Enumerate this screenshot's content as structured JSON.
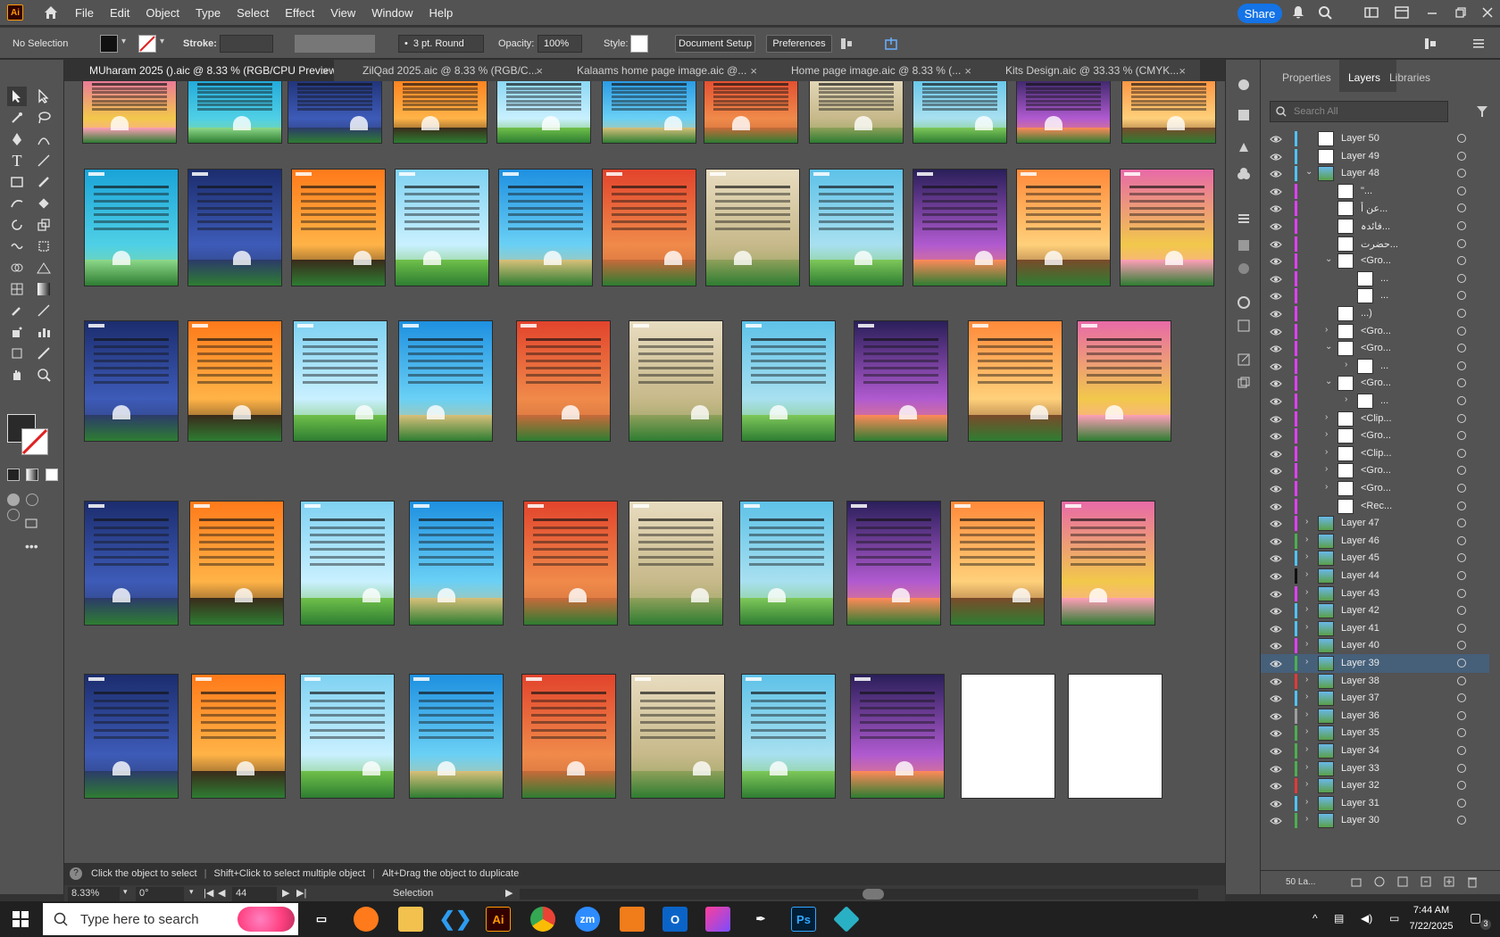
{
  "app": {
    "logo": "Ai",
    "menu": [
      "File",
      "Edit",
      "Object",
      "Type",
      "Select",
      "Effect",
      "View",
      "Window",
      "Help"
    ],
    "share_label": "Share"
  },
  "control_bar": {
    "selection_status": "No Selection",
    "stroke_label": "Stroke:",
    "brush_value": "3 pt. Round",
    "opacity_label": "Opacity:",
    "opacity_value": "100%",
    "style_label": "Style:",
    "document_setup_label": "Document Setup",
    "preferences_label": "Preferences"
  },
  "tabs": [
    {
      "label": "MUharam 2025 ().aic @ 8.33 % (RGB/CPU Preview)",
      "active": true
    },
    {
      "label": "ZilQad 2025.aic @ 8.33 % (RGB/C...",
      "active": false
    },
    {
      "label": "Kalaams home page image.aic @...",
      "active": false
    },
    {
      "label": "Home page image.aic @ 8.33 % (...",
      "active": false
    },
    {
      "label": "Kits Design.aic @ 33.33 % (CMYK...",
      "active": false
    }
  ],
  "panel_tabs": [
    "Properties",
    "Layers",
    "Libraries"
  ],
  "layers_search_placeholder": "Search All",
  "layers": [
    {
      "name": "Layer 50",
      "indent": 0,
      "color": "#4fc3f7",
      "chevron": "",
      "selected": false
    },
    {
      "name": "Layer 49",
      "indent": 0,
      "color": "#4fc3f7",
      "chevron": "",
      "selected": false
    },
    {
      "name": "Layer 48",
      "indent": 0,
      "color": "#4fc3f7",
      "chevron": "v",
      "selected": false
    },
    {
      "name": "\"...",
      "indent": 1,
      "color": "#e040fb",
      "chevron": "",
      "selected": false
    },
    {
      "name": "عن أ...",
      "indent": 1,
      "color": "#e040fb",
      "chevron": "",
      "selected": false
    },
    {
      "name": "فائدہ...",
      "indent": 1,
      "color": "#e040fb",
      "chevron": "",
      "selected": false
    },
    {
      "name": "حضرت...",
      "indent": 1,
      "color": "#e040fb",
      "chevron": "",
      "selected": false
    },
    {
      "name": "<Gro...",
      "indent": 1,
      "color": "#e040fb",
      "chevron": "v",
      "selected": false
    },
    {
      "name": "...",
      "indent": 2,
      "color": "#e040fb",
      "chevron": "",
      "selected": false
    },
    {
      "name": "...",
      "indent": 2,
      "color": "#e040fb",
      "chevron": "",
      "selected": false
    },
    {
      "name": "...)",
      "indent": 1,
      "color": "#e040fb",
      "chevron": "",
      "selected": false
    },
    {
      "name": "<Gro...",
      "indent": 1,
      "color": "#e040fb",
      "chevron": ">",
      "selected": false
    },
    {
      "name": "<Gro...",
      "indent": 1,
      "color": "#e040fb",
      "chevron": "v",
      "selected": false
    },
    {
      "name": "...",
      "indent": 2,
      "color": "#e040fb",
      "chevron": ">",
      "selected": false
    },
    {
      "name": "<Gro...",
      "indent": 1,
      "color": "#e040fb",
      "chevron": "v",
      "selected": false
    },
    {
      "name": "...",
      "indent": 2,
      "color": "#e040fb",
      "chevron": ">",
      "selected": false
    },
    {
      "name": "<Clip...",
      "indent": 1,
      "color": "#e040fb",
      "chevron": ">",
      "selected": false
    },
    {
      "name": "<Gro...",
      "indent": 1,
      "color": "#e040fb",
      "chevron": ">",
      "selected": false
    },
    {
      "name": "<Clip...",
      "indent": 1,
      "color": "#e040fb",
      "chevron": ">",
      "selected": false
    },
    {
      "name": "<Gro...",
      "indent": 1,
      "color": "#e040fb",
      "chevron": ">",
      "selected": false
    },
    {
      "name": "<Gro...",
      "indent": 1,
      "color": "#e040fb",
      "chevron": ">",
      "selected": false
    },
    {
      "name": "<Rec...",
      "indent": 1,
      "color": "#e040fb",
      "chevron": "",
      "selected": false
    },
    {
      "name": "Layer 47",
      "indent": 0,
      "color": "#e040fb",
      "chevron": ">",
      "selected": false
    },
    {
      "name": "Layer 46",
      "indent": 0,
      "color": "#4caf50",
      "chevron": ">",
      "selected": false
    },
    {
      "name": "Layer 45",
      "indent": 0,
      "color": "#4fc3f7",
      "chevron": ">",
      "selected": false
    },
    {
      "name": "Layer 44",
      "indent": 0,
      "color": "#111111",
      "chevron": ">",
      "selected": false
    },
    {
      "name": "Layer 43",
      "indent": 0,
      "color": "#e040fb",
      "chevron": ">",
      "selected": false
    },
    {
      "name": "Layer 42",
      "indent": 0,
      "color": "#4fc3f7",
      "chevron": ">",
      "selected": false
    },
    {
      "name": "Layer 41",
      "indent": 0,
      "color": "#4fc3f7",
      "chevron": ">",
      "selected": false
    },
    {
      "name": "Layer 40",
      "indent": 0,
      "color": "#e040fb",
      "chevron": ">",
      "selected": false
    },
    {
      "name": "Layer 39",
      "indent": 0,
      "color": "#4caf50",
      "chevron": ">",
      "selected": true
    },
    {
      "name": "Layer 38",
      "indent": 0,
      "color": "#e53935",
      "chevron": ">",
      "selected": false
    },
    {
      "name": "Layer 37",
      "indent": 0,
      "color": "#4fc3f7",
      "chevron": ">",
      "selected": false
    },
    {
      "name": "Layer 36",
      "indent": 0,
      "color": "#9e9e9e",
      "chevron": ">",
      "selected": false
    },
    {
      "name": "Layer 35",
      "indent": 0,
      "color": "#4caf50",
      "chevron": ">",
      "selected": false
    },
    {
      "name": "Layer 34",
      "indent": 0,
      "color": "#4caf50",
      "chevron": ">",
      "selected": false
    },
    {
      "name": "Layer 33",
      "indent": 0,
      "color": "#4caf50",
      "chevron": ">",
      "selected": false
    },
    {
      "name": "Layer 32",
      "indent": 0,
      "color": "#e53935",
      "chevron": ">",
      "selected": false
    },
    {
      "name": "Layer 31",
      "indent": 0,
      "color": "#4fc3f7",
      "chevron": ">",
      "selected": false
    },
    {
      "name": "Layer 30",
      "indent": 0,
      "color": "#4caf50",
      "chevron": ">",
      "selected": false
    }
  ],
  "layers_footer": "50 La...",
  "hint": {
    "part1": "Click the object to select",
    "part2": "Shift+Click to select multiple object",
    "part3": "Alt+Drag the object to duplicate"
  },
  "status": {
    "zoom": "8.33%",
    "rotation": "0°",
    "artboard": "44",
    "tool": "Selection"
  },
  "taskbar": {
    "search_placeholder": "Type here to search",
    "time": "7:44 AM",
    "date": "7/22/2025",
    "notifications": "3"
  },
  "artboard_palettes": [
    [
      "#e86aa8",
      "#f2c84b",
      "#ff9fb8"
    ],
    [
      "#1aa3d8",
      "#4fd0e6",
      "#8ed98a"
    ],
    [
      "#1c2d6e",
      "#3d5bb8",
      "#2c3a6a"
    ],
    [
      "#ff7a1a",
      "#ffb347",
      "#3a2a1a"
    ],
    [
      "#7fd2f2",
      "#c9f0ff",
      "#6fc04a"
    ],
    [
      "#1e90e0",
      "#6ad0f5",
      "#d8c07a"
    ],
    [
      "#e2442c",
      "#f08a4a",
      "#c86a3a"
    ],
    [
      "#e8dcc0",
      "#c7b98a",
      "#8fa05a"
    ],
    [
      "#5ec2e8",
      "#a8e0f0",
      "#7ec85a"
    ],
    [
      "#2a1f5a",
      "#b05ad0",
      "#ff8a5a"
    ],
    [
      "#ff8a3a",
      "#ffd07a",
      "#7a4a2a"
    ]
  ],
  "icons": {
    "home": "home-icon",
    "bell": "bell-icon",
    "search": "search-icon",
    "eye": "eye-icon",
    "filter": "filter-icon",
    "windows": "windows-logo-icon"
  }
}
